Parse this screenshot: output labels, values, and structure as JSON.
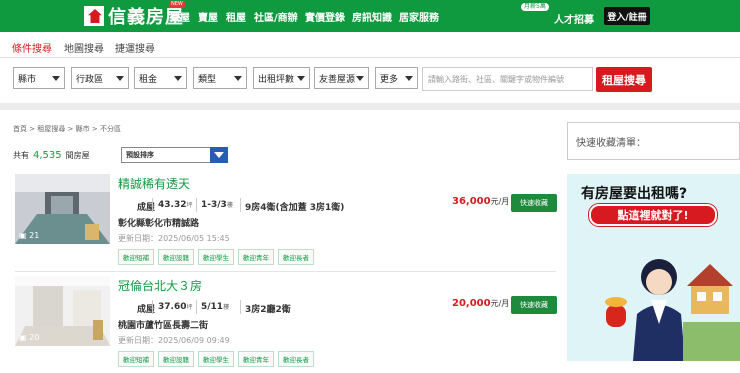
{
  "header": {
    "brand": "信義房屋",
    "nav": [
      "買屋",
      "賣屋",
      "租屋",
      "社區/商辦",
      "實價登錄",
      "房訊知識",
      "居家服務"
    ],
    "new_badge": "NEW",
    "jobs": "人才招募",
    "jobs_badge": "月薪5萬",
    "login": "登入/註冊",
    "colors": {
      "brand_green": "#0f9a3f",
      "accent_red": "#d71920"
    }
  },
  "tabs": [
    "條件搜尋",
    "地圖搜尋",
    "捷運搜尋"
  ],
  "filters": [
    "縣市",
    "行政區",
    "租金",
    "類型",
    "出租坪數",
    "友善屋源",
    "更多"
  ],
  "search": {
    "placeholder": "請輸入路街、社區、關鍵字或物件編號",
    "button": "租屋搜尋"
  },
  "breadcrumb": [
    "首頁",
    "租屋搜尋",
    "縣市",
    "不分區"
  ],
  "results": {
    "prefix": "共有",
    "count": "4,535",
    "suffix": "間房屋",
    "sort": "預設排序"
  },
  "listings": [
    {
      "title": "精誠稀有透天",
      "photo_count": "21",
      "type": "成屋",
      "size": "43.32",
      "size_unit": "坪",
      "floor": "1-3/3",
      "floor_unit": "樓",
      "layout": "9房4衛(含加蓋 3房1衛)",
      "address": "彰化縣彰化市精誠路",
      "updated": "更新日期：2025/06/05 15:45",
      "price": "36,000",
      "price_unit": "元/月",
      "fav": "快速收藏",
      "tags": [
        "歡迎短補",
        "歡迎設籍",
        "歡迎學生",
        "歡迎青年",
        "歡迎長者"
      ]
    },
    {
      "title": "冠倫台北大３房",
      "photo_count": "20",
      "type": "成屋",
      "size": "37.60",
      "size_unit": "坪",
      "floor": "5/11",
      "floor_unit": "樓",
      "layout": "3房2廳2衛",
      "address": "桃園市蘆竹區長壽二街",
      "updated": "更新日期：2025/06/09 09:49",
      "price": "20,000",
      "price_unit": "元/月",
      "fav": "快速收藏",
      "tags": [
        "歡迎短補",
        "歡迎設籍",
        "歡迎學生",
        "歡迎青年",
        "歡迎長者"
      ]
    }
  ],
  "sidebar": {
    "favorites": "快速收藏清單：",
    "ad_headline": "有房屋要出租嗎?",
    "ad_button": "點這裡就對了!"
  }
}
